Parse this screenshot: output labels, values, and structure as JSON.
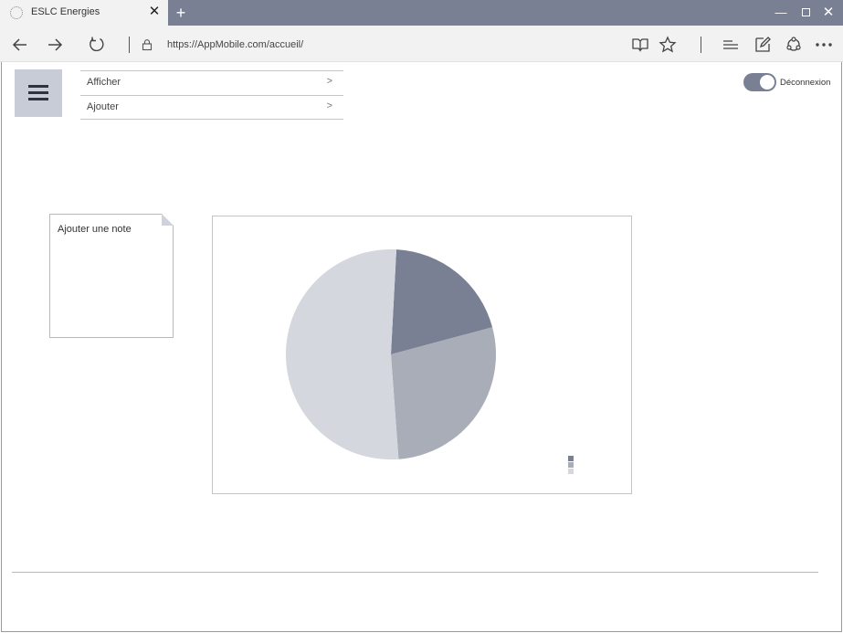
{
  "browser": {
    "tab_title": "ESLC Energies",
    "tab_close": "✕",
    "new_tab": "+",
    "url": "https://AppMobile.com/accueil/",
    "window_controls": {
      "minimize": "—",
      "close": "✕"
    }
  },
  "menu": {
    "items": [
      {
        "label": "Afficher",
        "chevron": ">"
      },
      {
        "label": "Ajouter",
        "chevron": ">"
      }
    ]
  },
  "logout_toggle": {
    "label": "Déconnexion",
    "state": "on"
  },
  "note": {
    "placeholder": "Ajouter une note"
  },
  "colors": {
    "accent": "#7a8094",
    "slice_light": "#d4d7de",
    "slice_mid": "#a9adb8",
    "slice_dark": "#7a8094"
  },
  "chart_data": {
    "type": "pie",
    "values": [
      20,
      28,
      52
    ],
    "colors": [
      "#7a8094",
      "#a9adb8",
      "#d4d7de"
    ],
    "start_angle_deg": 3,
    "legend": "bottom-right"
  }
}
